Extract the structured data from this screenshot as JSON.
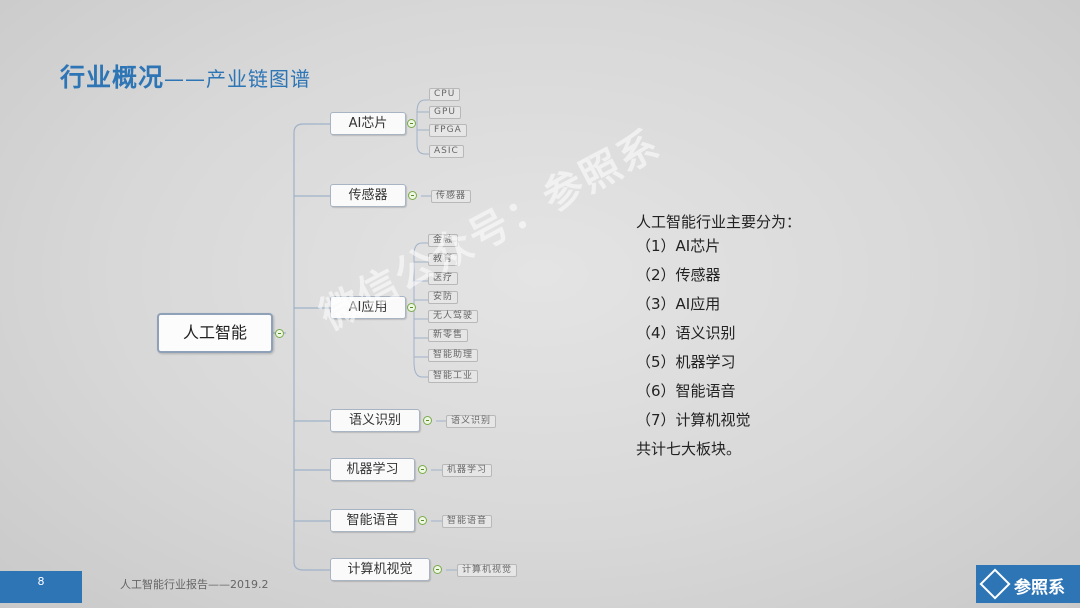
{
  "slide": {
    "title_main": "行业概况",
    "title_sub": "——产业链图谱",
    "page_number": "8",
    "footer_text": "人工智能行业报告——2019.2",
    "logo_text": "参照系",
    "watermark": "微信公众号：参照系"
  },
  "mindmap": {
    "root": "人工智能",
    "branches": [
      {
        "label": "AI芯片",
        "children": [
          "CPU",
          "GPU",
          "FPGA",
          "ASIC"
        ]
      },
      {
        "label": "传感器",
        "children": [
          "传感器"
        ]
      },
      {
        "label": "AI应用",
        "children": [
          "金融",
          "教育",
          "医疗",
          "安防",
          "无人驾驶",
          "新零售",
          "智能助理",
          "智能工业"
        ]
      },
      {
        "label": "语义识别",
        "children": [
          "语义识别"
        ]
      },
      {
        "label": "机器学习",
        "children": [
          "机器学习"
        ]
      },
      {
        "label": "智能语音",
        "children": [
          "智能语音"
        ]
      },
      {
        "label": "计算机视觉",
        "children": [
          "计算机视觉"
        ]
      }
    ]
  },
  "summary": {
    "intro": "人工智能行业主要分为：",
    "items": [
      "（1）AI芯片",
      "（2）传感器",
      "（3）AI应用",
      "（4）语义识别",
      "（5）机器学习",
      "（6）智能语音",
      "（7）计算机视觉"
    ],
    "conclusion": "共计七大板块。"
  }
}
